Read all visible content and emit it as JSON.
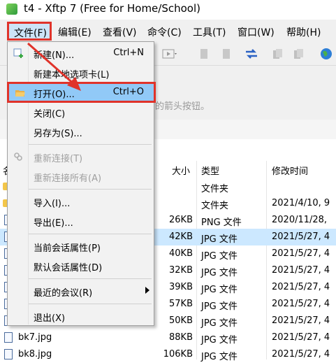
{
  "window": {
    "title": "t4 - Xftp 7 (Free for Home/School)"
  },
  "menubar": {
    "items": [
      "文件(F)",
      "编辑(E)",
      "查看(V)",
      "命令(C)",
      "工具(T)",
      "窗口(W)",
      "帮助(H)"
    ]
  },
  "session_area": {
    "hint": "的箭头按钮。"
  },
  "file_list": {
    "columns": {
      "size": "大小",
      "type": "类型",
      "modified": "修改时间"
    },
    "name_col_partial": "名",
    "rows": [
      {
        "name": "",
        "size": "",
        "type": "文件夹",
        "modified": ""
      },
      {
        "name": "",
        "size": "",
        "type": "文件夹",
        "modified": "2021/4/10, 9"
      },
      {
        "name": "",
        "size": "26KB",
        "type": "PNG 文件",
        "modified": "2020/11/28,"
      },
      {
        "name": "",
        "size": "42KB",
        "type": "JPG 文件",
        "modified": "2021/5/27, 4"
      },
      {
        "name": "",
        "size": "40KB",
        "type": "JPG 文件",
        "modified": "2021/5/27, 4"
      },
      {
        "name": "",
        "size": "32KB",
        "type": "JPG 文件",
        "modified": "2021/5/27, 4"
      },
      {
        "name": "",
        "size": "39KB",
        "type": "JPG 文件",
        "modified": "2021/5/27, 4"
      },
      {
        "name": "",
        "size": "57KB",
        "type": "JPG 文件",
        "modified": "2021/5/27, 4"
      },
      {
        "name": "",
        "size": "50KB",
        "type": "JPG 文件",
        "modified": "2021/5/27, 4"
      },
      {
        "name": "bk7.jpg",
        "size": "88KB",
        "type": "JPG 文件",
        "modified": "2021/5/27, 4"
      },
      {
        "name": "bk8.jpg",
        "size": "106KB",
        "type": "JPG 文件",
        "modified": "2021/5/27, 4"
      }
    ]
  },
  "file_menu": {
    "new": {
      "label": "新建(N)...",
      "shortcut": "Ctrl+N"
    },
    "new_local_tab": {
      "label": "新建本地选项卡(L)"
    },
    "open": {
      "label": "打开(O)...",
      "shortcut": "Ctrl+O"
    },
    "close": {
      "label": "关闭(C)"
    },
    "save_as": {
      "label": "另存为(S)..."
    },
    "reconnect": {
      "label": "重新连接(T)"
    },
    "reconnect_all": {
      "label": "重新连接所有(A)"
    },
    "import": {
      "label": "导入(I)..."
    },
    "export": {
      "label": "导出(E)..."
    },
    "current_session_props": {
      "label": "当前会话属性(P)"
    },
    "default_session_props": {
      "label": "默认会话属性(D)"
    },
    "recent_sessions": {
      "label": "最近的会议(R)"
    },
    "exit": {
      "label": "退出(X)"
    }
  },
  "colors": {
    "highlight": "#91c9f7",
    "annotation_red": "#e0332a",
    "selection": "#cce8ff"
  }
}
